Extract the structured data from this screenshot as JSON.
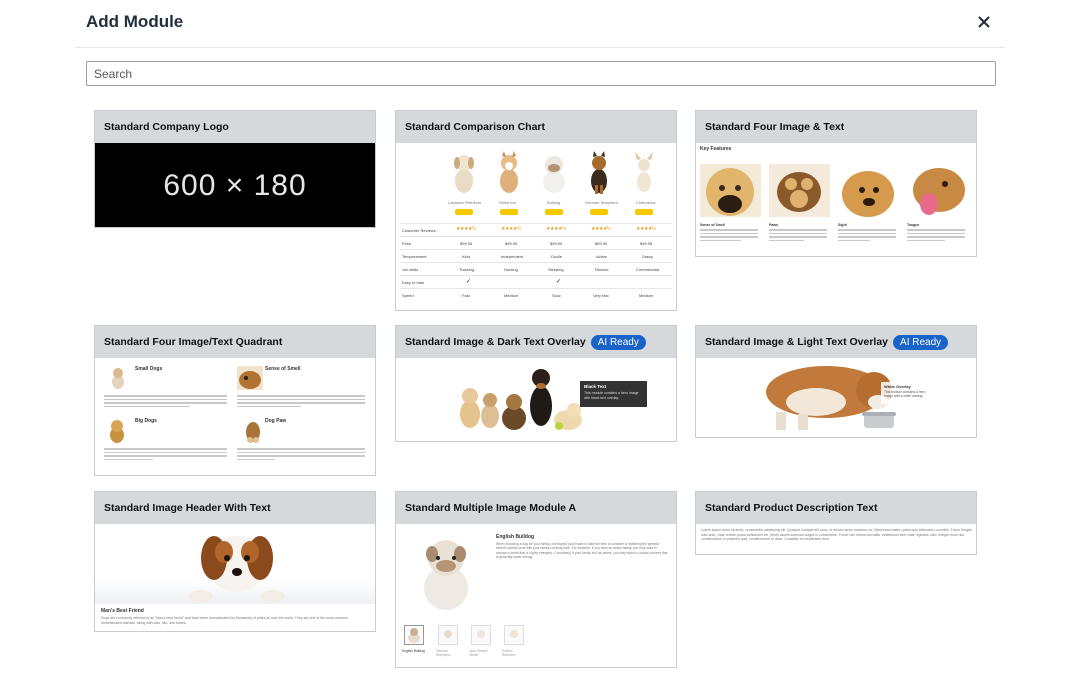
{
  "dialog": {
    "title": "Add Module"
  },
  "search": {
    "placeholder": "Search"
  },
  "modules": {
    "company_logo": {
      "title": "Standard Company Logo",
      "placeholder_text": "600 × 180"
    },
    "comparison_chart": {
      "title": "Standard Comparison Chart",
      "columns": [
        "Labrador Retriever",
        "Shiba Inu",
        "Bulldog",
        "German Shepherd",
        "Chihuahua"
      ],
      "button_label": "Add to cart",
      "rows": [
        {
          "label": "Customer Reviews",
          "values": [
            "★★★★½",
            "★★★★½",
            "★★★★½",
            "★★★★½",
            "★★★★½"
          ]
        },
        {
          "label": "Price",
          "values": [
            "$99.95",
            "$99.95",
            "$99.95",
            "$99.95",
            "$99.95"
          ]
        },
        {
          "label": "Temperament",
          "values": [
            "Kind",
            "Independent",
            "Docile",
            "Active",
            "Sassy"
          ]
        },
        {
          "label": "Job skills",
          "values": [
            "Tracking",
            "Hunting",
            "Sleeping",
            "Rescue",
            "Commercials"
          ]
        },
        {
          "label": "Easy to train",
          "values": [
            "✓",
            "",
            "✓",
            "",
            ""
          ]
        },
        {
          "label": "Speed",
          "values": [
            "Fast",
            "Medium",
            "Slow",
            "Very fast",
            "Medium"
          ]
        }
      ]
    },
    "four_image_text": {
      "title": "Standard Four Image & Text",
      "heading": "Key Features",
      "captions": [
        "Sense of Smell",
        "Paws",
        "Sight",
        "Tongue"
      ]
    },
    "quadrant": {
      "title": "Standard Four Image/Text Quadrant",
      "captions": [
        "Small Dogs",
        "Sense of Smell",
        "Big Dogs",
        "Dog Paw"
      ]
    },
    "dark_overlay": {
      "title": "Standard Image & Dark Text Overlay",
      "badge": "AI Ready",
      "overlay_heading": "Black Text",
      "overlay_text": "This module contains a hero image with black text overlay."
    },
    "light_overlay": {
      "title": "Standard Image & Light Text Overlay",
      "badge": "AI Ready",
      "overlay_heading": "White Overlay",
      "overlay_text": "This module contains a hero image with a white overlay."
    },
    "image_header": {
      "title": "Standard Image Header With Text",
      "heading": "Man's Best Friend",
      "text": "Dogs are commonly referred to as \"Man's best friend\" and have been domesticated for thousands of years all over the world. They are one of the most common domesticated animals, along with cats, fish, and turtles."
    },
    "multiple_image": {
      "title": "Standard Multiple Image Module A",
      "heading": "English Bulldog",
      "text": "When choosing a dog for your family, one aspect you'll want to take the time to consider is matching the general breed's activity level with your family's activity level. For instance, if you have an active family, you may want to choose a breed that is highly energetic. Conversely, if your family isn't as active, you may want to choose a breed that is generally lower energy.",
      "thumbs": [
        "English Bulldog",
        "German Shepherd",
        "Jack Russell Terrier",
        "Golden Retriever"
      ]
    },
    "product_description": {
      "title": "Standard Product Description Text",
      "text": "Lorem ipsum dolor sit amet, consectetur adipiscing elit. Quisque volutpat elit nunc, ut dictum lacus maximus ac. Maecenas mattis quam quis bibendum convallis. Fusce feugiat odio ante, vitae ornare purus sollicitudin vel. Morbi iaculis euismod augue in consectetur. Fusce nec metus convallis, vestibulum sem vitae, egestas odio. Integer risus nisi, condimentum in pharetra quis, condimentum in dolor. Curabitur eu vestibulum eros."
    }
  }
}
